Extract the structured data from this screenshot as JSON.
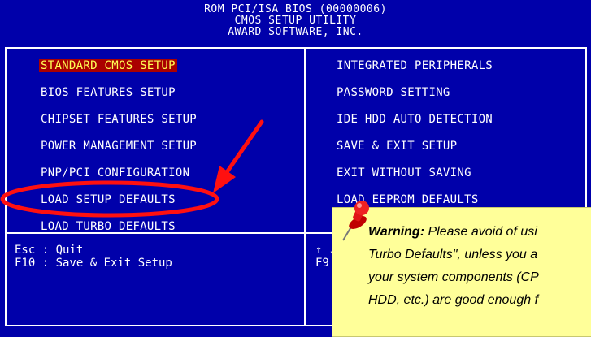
{
  "header": {
    "line1": "ROM PCI/ISA BIOS (00000006)",
    "line2": "CMOS SETUP UTILITY",
    "line3": "AWARD SOFTWARE, INC."
  },
  "menu": {
    "left": [
      "STANDARD CMOS SETUP",
      "BIOS FEATURES SETUP",
      "CHIPSET FEATURES SETUP",
      "POWER MANAGEMENT SETUP",
      "PNP/PCI CONFIGURATION",
      "LOAD SETUP DEFAULTS",
      "LOAD TURBO DEFAULTS"
    ],
    "right": [
      "INTEGRATED PERIPHERALS",
      "PASSWORD SETTING",
      "IDE HDD AUTO DETECTION",
      "SAVE & EXIT SETUP",
      "EXIT WITHOUT SAVING",
      "LOAD EEPROM DEFAULTS"
    ]
  },
  "footer": {
    "left_line1": "Esc : Quit",
    "left_line2": "F10 : Save & Exit Setup",
    "right_line1": "↑ ↓",
    "right_line2": "F9"
  },
  "note": {
    "bold_lead": "Warning:",
    "line1_rest": " Please avoid of usi",
    "line2": "Turbo Defaults\", unless you a",
    "line3": "your system components (CP",
    "line4": "HDD, etc.) are good enough f"
  },
  "colors": {
    "bios_bg": "#0000aa",
    "selected_bg": "#aa0000",
    "selected_fg": "#ffff55",
    "highlight_red": "#ff1010",
    "note_bg": "#ffff99"
  },
  "icons": {
    "arrow": "red-arrow-icon",
    "ellipse": "red-ellipse-highlight",
    "pin": "red-pushpin-icon"
  }
}
